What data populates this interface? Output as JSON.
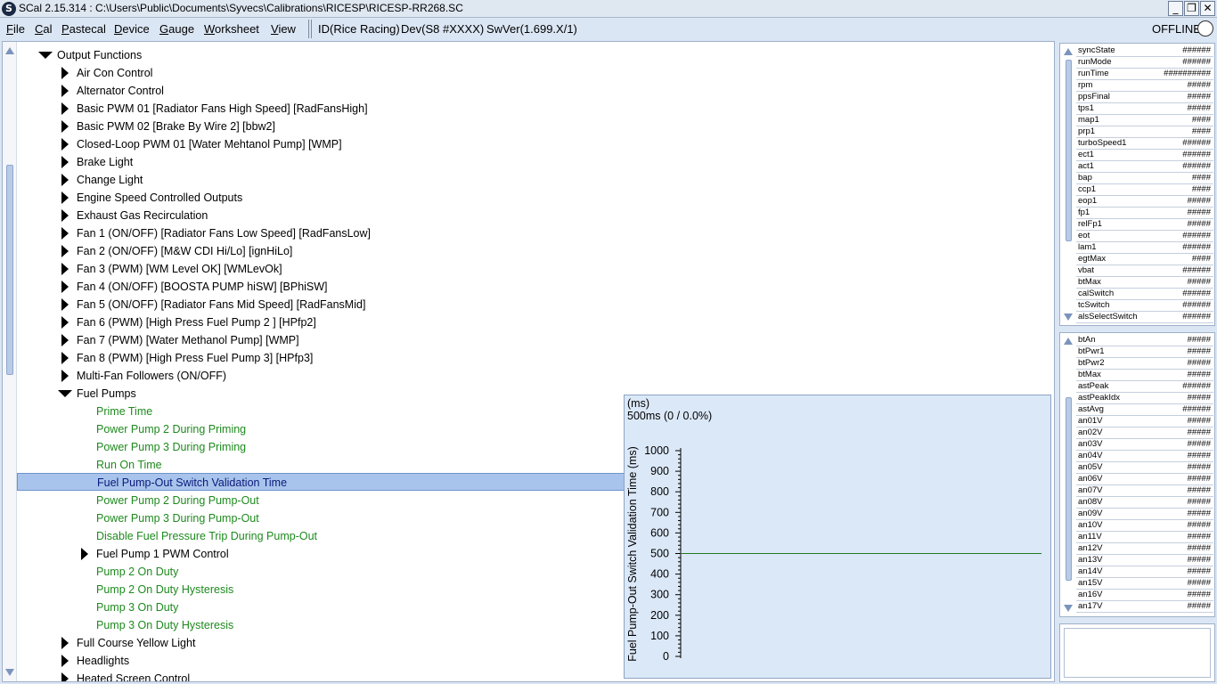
{
  "window": {
    "title": "SCal 2.15.314  :  C:\\Users\\Public\\Documents\\Syvecs\\Calibrations\\RICESP\\RICESP-RR268.SC",
    "icon_letter": "S",
    "minimize_glyph": "_",
    "maximize_glyph": "❐",
    "close_glyph": "✕"
  },
  "menu": {
    "items": [
      {
        "pre": "",
        "ul": "F",
        "post": "ile"
      },
      {
        "pre": "",
        "ul": "C",
        "post": "al"
      },
      {
        "pre": "",
        "ul": "P",
        "post": "astecal"
      },
      {
        "pre": "",
        "ul": "D",
        "post": "evice"
      },
      {
        "pre": "",
        "ul": "G",
        "post": "auge"
      },
      {
        "pre": "",
        "ul": "W",
        "post": "orksheet"
      },
      {
        "pre": "",
        "ul": "V",
        "post": "iew"
      }
    ],
    "id_info": "ID(Rice Racing)",
    "dev_info": "Dev(S8 #XXXX)",
    "sw_info": "SwVer(1.699.X/1)",
    "status": "OFFLINE"
  },
  "tree": {
    "rows": [
      {
        "label": "Output Functions",
        "indent": 0,
        "icon": "expanded"
      },
      {
        "label": "Air Con Control",
        "indent": 1,
        "icon": "collapsed"
      },
      {
        "label": "Alternator Control",
        "indent": 1,
        "icon": "collapsed"
      },
      {
        "label": "Basic PWM 01 [Radiator Fans High Speed] [RadFansHigh]",
        "indent": 1,
        "icon": "collapsed"
      },
      {
        "label": "Basic PWM 02 [Brake By Wire 2] [bbw2]",
        "indent": 1,
        "icon": "collapsed"
      },
      {
        "label": "Closed-Loop PWM 01 [Water Mehtanol Pump] [WMP]",
        "indent": 1,
        "icon": "collapsed"
      },
      {
        "label": "Brake Light",
        "indent": 1,
        "icon": "collapsed"
      },
      {
        "label": "Change Light",
        "indent": 1,
        "icon": "collapsed"
      },
      {
        "label": "Engine Speed Controlled Outputs",
        "indent": 1,
        "icon": "collapsed"
      },
      {
        "label": "Exhaust Gas Recirculation",
        "indent": 1,
        "icon": "collapsed"
      },
      {
        "label": "Fan 1 (ON/OFF) [Radiator Fans Low Speed] [RadFansLow]",
        "indent": 1,
        "icon": "collapsed"
      },
      {
        "label": "Fan 2 (ON/OFF) [M&W CDI Hi/Lo] [ignHiLo]",
        "indent": 1,
        "icon": "collapsed"
      },
      {
        "label": "Fan 3 (PWM) [WM Level OK] [WMLevOk]",
        "indent": 1,
        "icon": "collapsed"
      },
      {
        "label": "Fan 4 (ON/OFF) [BOOSTA PUMP hiSW] [BPhiSW]",
        "indent": 1,
        "icon": "collapsed"
      },
      {
        "label": "Fan 5 (ON/OFF) [Radiator Fans Mid Speed] [RadFansMid]",
        "indent": 1,
        "icon": "collapsed"
      },
      {
        "label": "Fan 6 (PWM) [High Press Fuel Pump 2 ] [HPfp2]",
        "indent": 1,
        "icon": "collapsed"
      },
      {
        "label": "Fan 7 (PWM) [Water Methanol Pump] [WMP]",
        "indent": 1,
        "icon": "collapsed"
      },
      {
        "label": "Fan 8 (PWM) [High Press Fuel Pump 3] [HPfp3]",
        "indent": 1,
        "icon": "collapsed"
      },
      {
        "label": "Multi-Fan Followers (ON/OFF)",
        "indent": 1,
        "icon": "collapsed"
      },
      {
        "label": "Fuel Pumps",
        "indent": 1,
        "icon": "expanded"
      },
      {
        "label": "Prime Time",
        "indent": 2,
        "icon": "leaf"
      },
      {
        "label": "Power Pump 2 During Priming",
        "indent": 2,
        "icon": "leaf"
      },
      {
        "label": "Power Pump 3 During Priming",
        "indent": 2,
        "icon": "leaf"
      },
      {
        "label": "Run On Time",
        "indent": 2,
        "icon": "leaf"
      },
      {
        "label": "Fuel Pump-Out Switch Validation Time",
        "indent": 2,
        "icon": "leaf",
        "selected": true
      },
      {
        "label": "Power Pump 2 During Pump-Out",
        "indent": 2,
        "icon": "leaf"
      },
      {
        "label": "Power Pump 3 During Pump-Out",
        "indent": 2,
        "icon": "leaf"
      },
      {
        "label": "Disable Fuel Pressure Trip During Pump-Out",
        "indent": 2,
        "icon": "leaf"
      },
      {
        "label": "Fuel Pump 1 PWM Control",
        "indent": 2,
        "icon": "collapsed"
      },
      {
        "label": "Pump 2 On Duty",
        "indent": 2,
        "icon": "leaf"
      },
      {
        "label": "Pump 2 On Duty Hysteresis",
        "indent": 2,
        "icon": "leaf"
      },
      {
        "label": "Pump 3 On Duty",
        "indent": 2,
        "icon": "leaf"
      },
      {
        "label": "Pump 3 On Duty Hysteresis",
        "indent": 2,
        "icon": "leaf"
      },
      {
        "label": "Full Course Yellow Light",
        "indent": 1,
        "icon": "collapsed"
      },
      {
        "label": "Headlights",
        "indent": 1,
        "icon": "collapsed"
      },
      {
        "label": "Heated Screen Control",
        "indent": 1,
        "icon": "collapsed"
      }
    ]
  },
  "graph": {
    "units": "(ms)",
    "current": "500ms (0 / 0.0%)",
    "line_color": "#1e7a1e"
  },
  "chart_data": {
    "type": "line",
    "ylabel": "Fuel Pump-Out Switch Validation Time (ms)",
    "yticks": [
      "0",
      "100",
      "200",
      "300",
      "400",
      "500",
      "600",
      "700",
      "800",
      "900",
      "1000"
    ],
    "ylim": [
      0,
      1000
    ],
    "series": [
      {
        "values": [
          500,
          500
        ]
      }
    ],
    "grid": false
  },
  "gauges_top": [
    {
      "name": "syncState",
      "value": "######"
    },
    {
      "name": "runMode",
      "value": "######"
    },
    {
      "name": "runTime",
      "value": "##########"
    },
    {
      "name": "rpm",
      "value": "#####"
    },
    {
      "name": "ppsFinal",
      "value": "#####"
    },
    {
      "name": "tps1",
      "value": "#####"
    },
    {
      "name": "map1",
      "value": "####"
    },
    {
      "name": "prp1",
      "value": "####"
    },
    {
      "name": "turboSpeed1",
      "value": "######"
    },
    {
      "name": "ect1",
      "value": "######"
    },
    {
      "name": "act1",
      "value": "######"
    },
    {
      "name": "bap",
      "value": "####"
    },
    {
      "name": "ccp1",
      "value": "####"
    },
    {
      "name": "eop1",
      "value": "#####"
    },
    {
      "name": "fp1",
      "value": "#####"
    },
    {
      "name": "relFp1",
      "value": "#####"
    },
    {
      "name": "eot",
      "value": "######"
    },
    {
      "name": "lam1",
      "value": "######"
    },
    {
      "name": "egtMax",
      "value": "####"
    },
    {
      "name": "vbat",
      "value": "######"
    },
    {
      "name": "btMax",
      "value": "#####"
    },
    {
      "name": "calSwitch",
      "value": "######"
    },
    {
      "name": "tcSwitch",
      "value": "######"
    },
    {
      "name": "alsSelectSwitch",
      "value": "######"
    }
  ],
  "gauges_bottom": [
    {
      "name": "btAn",
      "value": "#####"
    },
    {
      "name": "btPwr1",
      "value": "#####"
    },
    {
      "name": "btPwr2",
      "value": "#####"
    },
    {
      "name": "btMax",
      "value": "#####"
    },
    {
      "name": "astPeak",
      "value": "######"
    },
    {
      "name": "astPeakIdx",
      "value": "#####"
    },
    {
      "name": "astAvg",
      "value": "######"
    },
    {
      "name": "an01V",
      "value": "#####"
    },
    {
      "name": "an02V",
      "value": "#####"
    },
    {
      "name": "an03V",
      "value": "#####"
    },
    {
      "name": "an04V",
      "value": "#####"
    },
    {
      "name": "an05V",
      "value": "#####"
    },
    {
      "name": "an06V",
      "value": "#####"
    },
    {
      "name": "an07V",
      "value": "#####"
    },
    {
      "name": "an08V",
      "value": "#####"
    },
    {
      "name": "an09V",
      "value": "#####"
    },
    {
      "name": "an10V",
      "value": "#####"
    },
    {
      "name": "an11V",
      "value": "#####"
    },
    {
      "name": "an12V",
      "value": "#####"
    },
    {
      "name": "an13V",
      "value": "#####"
    },
    {
      "name": "an14V",
      "value": "#####"
    },
    {
      "name": "an15V",
      "value": "#####"
    },
    {
      "name": "an16V",
      "value": "#####"
    },
    {
      "name": "an17V",
      "value": "#####"
    }
  ]
}
